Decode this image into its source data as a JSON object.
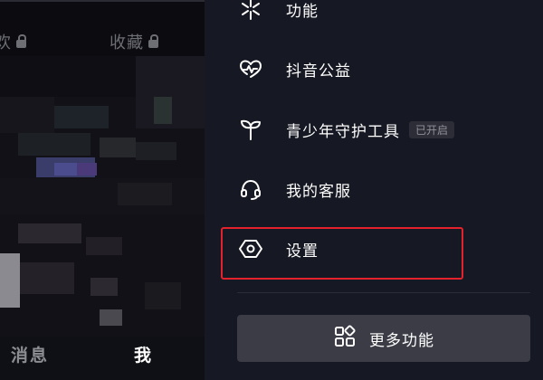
{
  "profile_tabs": [
    {
      "label": "欢",
      "locked": true
    },
    {
      "label": "收藏",
      "locked": true
    }
  ],
  "bottom_nav": {
    "messages": "消息",
    "me": "我"
  },
  "drawer": {
    "menu": [
      {
        "label": "功能",
        "icon": "spark-icon"
      },
      {
        "label": "抖音公益",
        "icon": "charity-heart-icon"
      },
      {
        "label": "青少年守护工具",
        "icon": "sprout-icon",
        "badge": "已开启"
      },
      {
        "label": "我的客服",
        "icon": "headset-icon"
      },
      {
        "label": "设置",
        "icon": "settings-hexagon-icon",
        "highlighted": true
      }
    ],
    "more_button": {
      "label": "更多功能",
      "icon": "apps-grid-icon"
    }
  },
  "colors": {
    "drawer_bg": "#161823",
    "highlight": "#e3222b",
    "text": "#ffffff",
    "badge_bg": "#2c2d37"
  }
}
